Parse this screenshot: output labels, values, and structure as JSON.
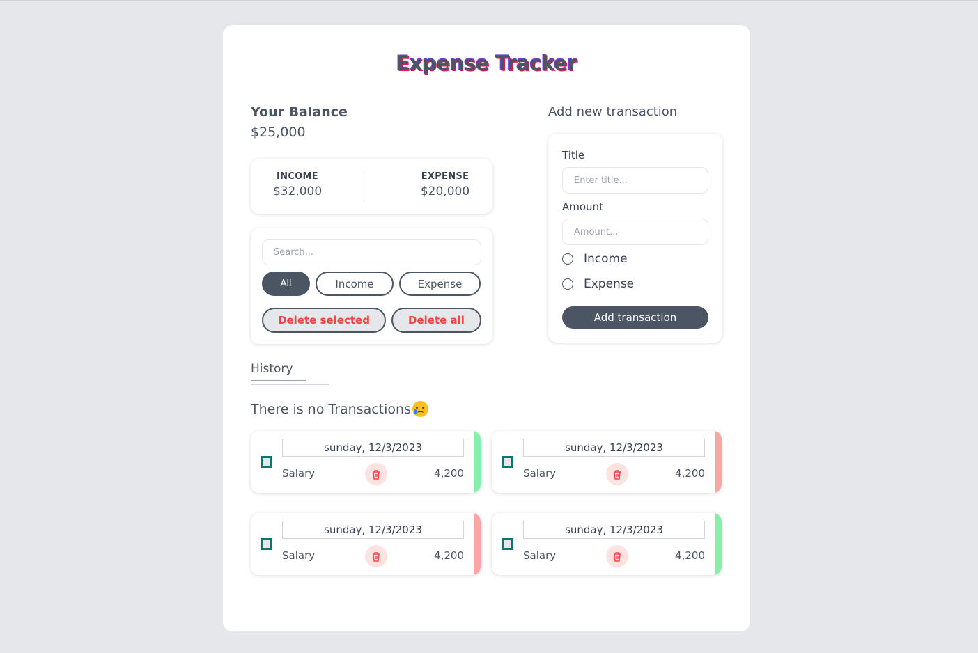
{
  "app": {
    "title": "Expense Tracker"
  },
  "balance": {
    "label": "Your Balance",
    "value": "$25,000"
  },
  "summary": {
    "income_label": "INCOME",
    "income_value": "$32,000",
    "expense_label": "EXPENSE",
    "expense_value": "$20,000"
  },
  "filters": {
    "search_placeholder": "Search...",
    "all_label": "All",
    "income_label": "Income",
    "expense_label": "Expense",
    "delete_selected_label": "Delete selected",
    "delete_all_label": "Delete all"
  },
  "form": {
    "heading": "Add new transaction",
    "title_label": "Title",
    "title_placeholder": "Enter title...",
    "amount_label": "Amount",
    "amount_placeholder": "Amount...",
    "income_option": "Income",
    "expense_option": "Expense",
    "submit_label": "Add transaction"
  },
  "history": {
    "label": "History",
    "empty_message": "There is no Transactions",
    "transactions": [
      {
        "date": "sunday, 12/3/2023",
        "title": "Salary",
        "amount": "4,200",
        "type": "income"
      },
      {
        "date": "sunday, 12/3/2023",
        "title": "Salary",
        "amount": "4,200",
        "type": "expense"
      },
      {
        "date": "sunday, 12/3/2023",
        "title": "Salary",
        "amount": "4,200",
        "type": "expense"
      },
      {
        "date": "sunday, 12/3/2023",
        "title": "Salary",
        "amount": "4,200",
        "type": "income"
      }
    ]
  },
  "colors": {
    "income": "#86efac",
    "expense": "#fca5a5",
    "accent": "#4b5563",
    "danger": "#ef4444",
    "check": "#0f766e"
  }
}
